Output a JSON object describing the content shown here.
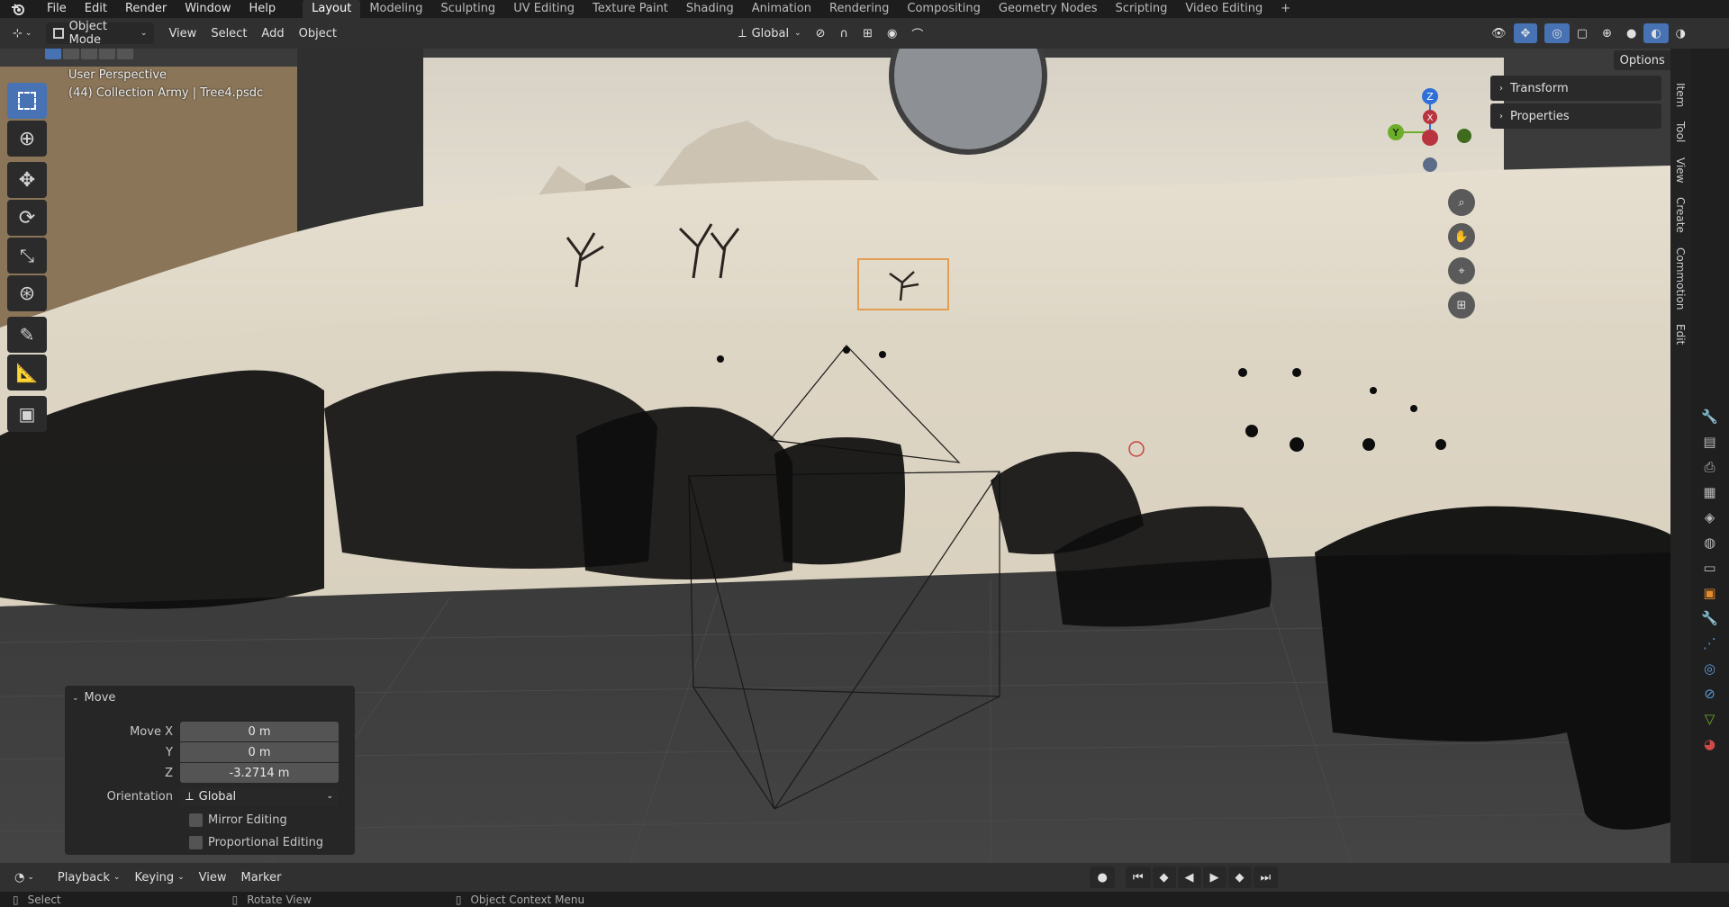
{
  "menu": [
    "File",
    "Edit",
    "Render",
    "Window",
    "Help"
  ],
  "workspaces": [
    "Layout",
    "Modeling",
    "Sculpting",
    "UV Editing",
    "Texture Paint",
    "Shading",
    "Animation",
    "Rendering",
    "Compositing",
    "Geometry Nodes",
    "Scripting",
    "Video Editing"
  ],
  "active_workspace": "Layout",
  "header": {
    "mode": "Object Mode",
    "items": [
      "View",
      "Select",
      "Add",
      "Object"
    ],
    "orientation": "Global",
    "options": "Options"
  },
  "viewport": {
    "perspective": "User Perspective",
    "collection": "(44) Collection Army | Tree4.psdc"
  },
  "npanel": [
    "Transform",
    "Properties"
  ],
  "vtabs": [
    "Item",
    "Tool",
    "View",
    "Create",
    "Commotion",
    "Edit"
  ],
  "gizmo": {
    "z": "Z",
    "y": "Y",
    "x": "X"
  },
  "move_panel": {
    "title": "Move",
    "move_x_label": "Move X",
    "move_x": "0 m",
    "y_label": "Y",
    "y": "0 m",
    "z_label": "Z",
    "z": "-3.2714 m",
    "orientation_label": "Orientation",
    "orientation": "Global",
    "mirror": "Mirror Editing",
    "proportional": "Proportional Editing"
  },
  "timeline": [
    "Playback",
    "Keying",
    "View",
    "Marker"
  ],
  "status": [
    "Select",
    "Rotate View",
    "Object Context Menu"
  ]
}
